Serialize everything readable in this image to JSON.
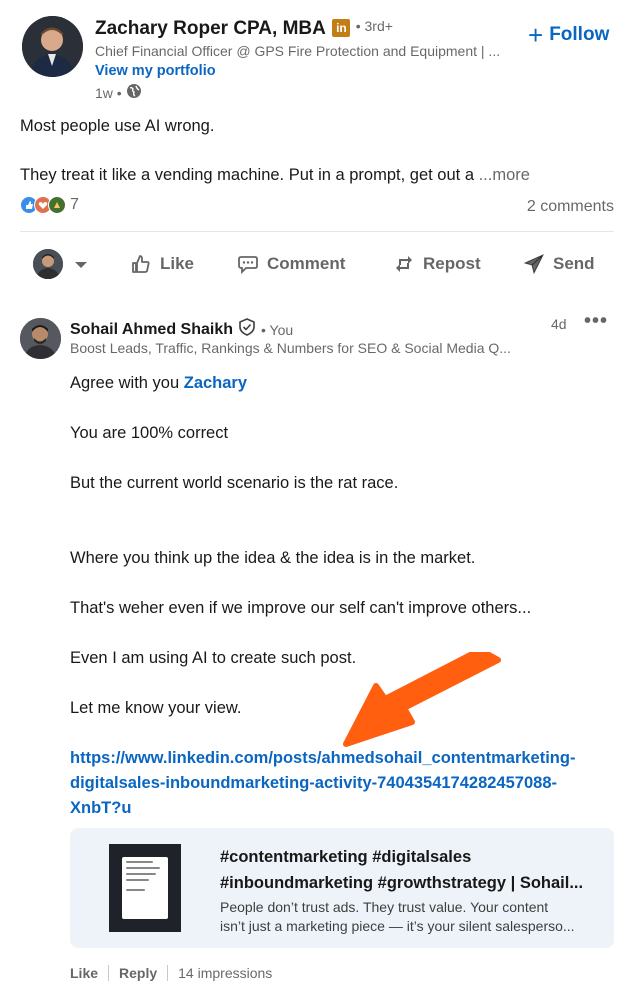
{
  "post": {
    "author": {
      "name": "Zachary Roper CPA, MBA",
      "badge": "in",
      "degree": "• 3rd+",
      "title": "Chief Financial Officer @ GPS Fire Protection and Equipment | ...",
      "portfolio_link": "View my portfolio",
      "time": "1w •"
    },
    "follow_label": "Follow",
    "text_line1": "Most people use AI wrong.",
    "text_line2": "They treat it like a vending machine. Put in a prompt, get out a",
    "more_label": "...more",
    "reaction_count": "7",
    "comments_count": "2 comments"
  },
  "actions": {
    "like": "Like",
    "comment": "Comment",
    "repost": "Repost",
    "send": "Send"
  },
  "comment": {
    "author": "Sohail Ahmed Shaikh",
    "you_label": "• You",
    "headline": "Boost Leads, Traffic, Rankings & Numbers for SEO & Social Media Q...",
    "time": "4d",
    "menu": "•••",
    "line1_prefix": "Agree with you ",
    "line1_mention": "Zachary",
    "line2": "You are 100% correct",
    "line3": "But the current world scenario is the rat race.",
    "line4": "Where you think up the idea & the idea is in the market.",
    "line5": "That's weher even if we improve our self can't improve others...",
    "line6": "Even I am using AI to create such post.",
    "line7": "Let me know your view.",
    "link_line1": "https://www.linkedin.com/posts/ahmedsohail_contentmarketing-",
    "link_line2": "digitalsales-inboundmarketing-activity-7404354174282457088-",
    "link_line3": "XnbT?u",
    "preview": {
      "title_line1": "#contentmarketing #digitalsales",
      "title_line2": "#inboundmarketing #growthstrategy | Sohail...",
      "desc_line1": "People don’t trust ads. They trust value. Your content",
      "desc_line2": "isn’t just a marketing piece — it’s your silent salesperso..."
    },
    "like_label": "Like",
    "reply_label": "Reply",
    "impressions": "14 impressions"
  },
  "colors": {
    "link_blue": "#0a66c2",
    "arrow_orange": "#ff5f0f",
    "preview_bg": "#edf3f8"
  }
}
